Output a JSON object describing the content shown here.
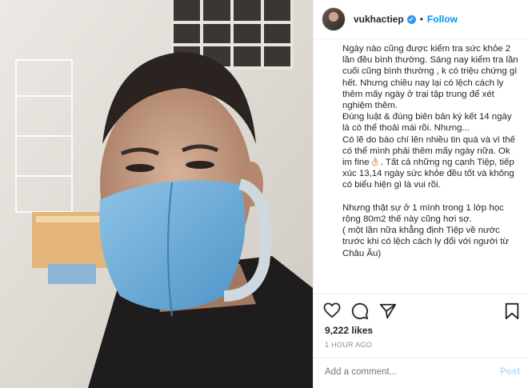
{
  "photo": {
    "description_icon": "selfie-photo"
  },
  "header": {
    "username": "vukhactiep",
    "verified_icon": "✔",
    "separator": "•",
    "follow_label": "Follow"
  },
  "caption": {
    "text": "Ngày nào cũng được kiểm tra sức khỏe 2 lần đều bình thường. Sáng nay kiểm tra lần cuối cũng bình thường , k có triệu chứng gì hết. Nhưng chiều nay lại có lệch cách ly thêm mấy ngày ở trại tập trung để xét nghiệm thêm.\nĐúng luật & đúng biên bản ký kết 14 ngày là có thể thoải mái rồi. Nhưng...\nCó lẽ do báo chí lên nhiều tin quá và vì thế có thể mình phải thêm mấy ngày nữa. Ok im fine👌🏻. Tất cả những ng cạnh Tiệp, tiếp xúc 13,14 ngày sức khỏe đều tốt và không có biểu hiện gì là vui rồi.\n\nNhưng thật sự ở 1 mình trong 1 lớp học rộng 80m2 thế này cũng hơi sợ.\n( một lần nữa khẳng định Tiệp về nước trước khi có lệch cách ly đổi với người từ Châu Âu)"
  },
  "actions": {
    "icons": [
      "heart-icon",
      "comment-icon",
      "share-icon",
      "bookmark-icon"
    ]
  },
  "likes": "9,222 likes",
  "timestamp": "1 HOUR AGO",
  "comment": {
    "placeholder": "Add a comment...",
    "post_label": "Post"
  },
  "colors": {
    "accent": "#0095f6",
    "post_disabled": "#b2dffc",
    "muted": "#8e8e8e",
    "text": "#262626"
  }
}
